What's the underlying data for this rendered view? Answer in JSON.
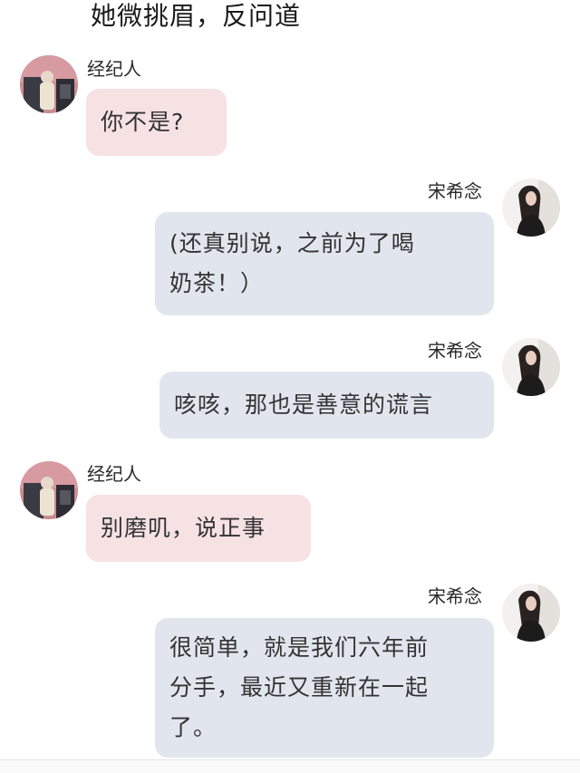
{
  "narration": "她微挑眉，反问道",
  "colors": {
    "agent_bubble": "#f6e1e3",
    "self_bubble": "#e1e6ee"
  },
  "messages": [
    {
      "sender": "经纪人",
      "side": "left",
      "text": "你不是?",
      "avatar_icon": "agent-avatar"
    },
    {
      "sender": "宋希念",
      "side": "right",
      "text": "(还真别说，之前为了喝\n奶茶！）",
      "avatar_icon": "songxinian-avatar"
    },
    {
      "sender": "宋希念",
      "side": "right",
      "text": "咳咳，那也是善意的谎言",
      "avatar_icon": "songxinian-avatar"
    },
    {
      "sender": "经纪人",
      "side": "left",
      "text": "别磨叽，说正事",
      "avatar_icon": "agent-avatar"
    },
    {
      "sender": "宋希念",
      "side": "right",
      "text": "很简单，就是我们六年前\n分手，最近又重新在一起\n了。",
      "avatar_icon": "songxinian-avatar"
    }
  ]
}
